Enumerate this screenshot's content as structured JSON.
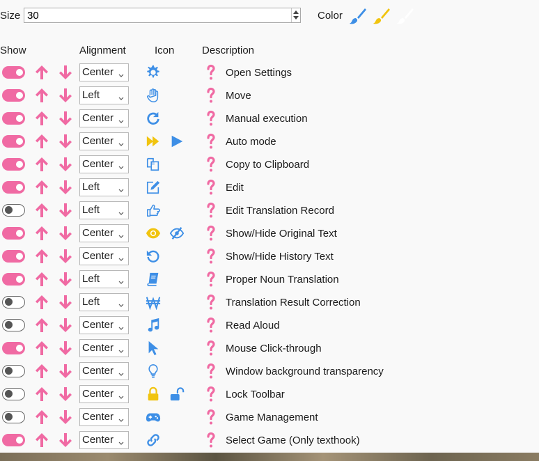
{
  "size": {
    "label": "Size",
    "value": "30"
  },
  "color": {
    "label": "Color",
    "swatches": [
      {
        "name": "blue-brush",
        "hex": "#3e8fe6"
      },
      {
        "name": "yellow-brush",
        "hex": "#f1c40f"
      },
      {
        "name": "white-brush",
        "hex": "#ffffff"
      }
    ]
  },
  "headers": {
    "show": "Show",
    "alignment": "Alignment",
    "icon": "Icon",
    "description": "Description"
  },
  "colors": {
    "accent": "#f06aa3",
    "icon_blue": "#3e8fe6",
    "icon_yellow": "#f1c40f"
  },
  "rows": [
    {
      "on": true,
      "alignment": "Center",
      "icons": [
        "gear-icon"
      ],
      "description": "Open Settings"
    },
    {
      "on": true,
      "alignment": "Left",
      "icons": [
        "hand-icon"
      ],
      "description": "Move"
    },
    {
      "on": true,
      "alignment": "Center",
      "icons": [
        "redo-icon"
      ],
      "description": "Manual execution"
    },
    {
      "on": true,
      "alignment": "Center",
      "icons": [
        "fast-forward-icon",
        "play-icon"
      ],
      "description": "Auto mode"
    },
    {
      "on": true,
      "alignment": "Center",
      "icons": [
        "copy-icon"
      ],
      "description": "Copy to Clipboard"
    },
    {
      "on": true,
      "alignment": "Left",
      "icons": [
        "edit-icon"
      ],
      "description": "Edit"
    },
    {
      "on": false,
      "alignment": "Left",
      "icons": [
        "hand-point-icon"
      ],
      "description": "Edit Translation Record"
    },
    {
      "on": true,
      "alignment": "Center",
      "icons": [
        "eye-icon",
        "eye-slash-icon"
      ],
      "description": "Show/Hide Original Text"
    },
    {
      "on": true,
      "alignment": "Center",
      "icons": [
        "history-icon"
      ],
      "description": "Show/Hide History Text"
    },
    {
      "on": true,
      "alignment": "Left",
      "icons": [
        "book-icon"
      ],
      "description": "Proper Noun Translation"
    },
    {
      "on": false,
      "alignment": "Left",
      "icons": [
        "won-icon"
      ],
      "description": "Translation Result Correction"
    },
    {
      "on": false,
      "alignment": "Center",
      "icons": [
        "music-icon"
      ],
      "description": "Read Aloud"
    },
    {
      "on": true,
      "alignment": "Center",
      "icons": [
        "cursor-icon"
      ],
      "description": "Mouse Click-through"
    },
    {
      "on": false,
      "alignment": "Center",
      "icons": [
        "lightbulb-icon"
      ],
      "description": "Window background transparency"
    },
    {
      "on": false,
      "alignment": "Center",
      "icons": [
        "lock-icon",
        "unlock-icon"
      ],
      "description": "Lock Toolbar"
    },
    {
      "on": false,
      "alignment": "Center",
      "icons": [
        "gamepad-icon"
      ],
      "description": "Game Management"
    },
    {
      "on": true,
      "alignment": "Center",
      "icons": [
        "link-icon"
      ],
      "description": "Select Game (Only texthook)"
    }
  ]
}
